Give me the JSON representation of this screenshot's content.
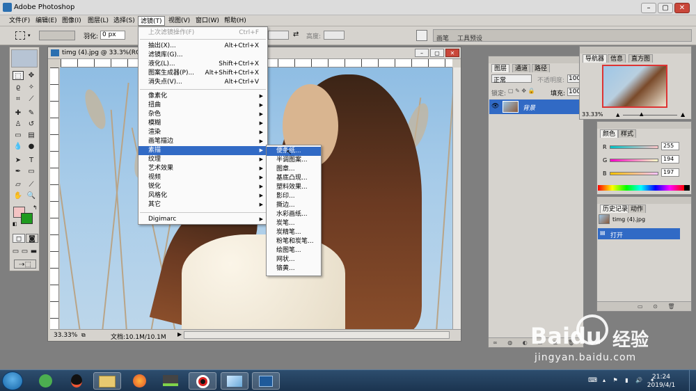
{
  "app": {
    "title": "Adobe Photoshop"
  },
  "menubar": [
    "文件(F)",
    "编辑(E)",
    "图像(I)",
    "图层(L)",
    "选择(S)",
    "滤镜(T)",
    "视图(V)",
    "窗口(W)",
    "帮助(H)"
  ],
  "options": {
    "feather_label": "羽化:",
    "feather_value": "0 px",
    "height_label": "高度:"
  },
  "palette_well": {
    "tabs": [
      "画笔",
      "工具预设"
    ]
  },
  "document": {
    "title": "timg (4).jpg @ 33.3%(RGB",
    "zoom": "33.33%",
    "doc_info": "文档:10.1M/10.1M"
  },
  "filter_menu": {
    "items": [
      {
        "label": "上次滤镜操作(F)",
        "shortcut": "Ctrl+F",
        "disabled": true
      },
      {
        "label": "抽出(X)...",
        "shortcut": "Alt+Ctrl+X"
      },
      {
        "label": "滤镜库(G)...",
        "shortcut": ""
      },
      {
        "label": "液化(L)...",
        "shortcut": "Shift+Ctrl+X"
      },
      {
        "label": "图案生成器(P)...",
        "shortcut": "Alt+Shift+Ctrl+X"
      },
      {
        "label": "消失点(V)...",
        "shortcut": "Alt+Ctrl+V"
      },
      {
        "label": "像素化",
        "submenu": true
      },
      {
        "label": "扭曲",
        "submenu": true
      },
      {
        "label": "杂色",
        "submenu": true
      },
      {
        "label": "模糊",
        "submenu": true
      },
      {
        "label": "渲染",
        "submenu": true
      },
      {
        "label": "画笔描边",
        "submenu": true
      },
      {
        "label": "素描",
        "submenu": true,
        "highlighted": true
      },
      {
        "label": "纹理",
        "submenu": true
      },
      {
        "label": "艺术效果",
        "submenu": true
      },
      {
        "label": "视频",
        "submenu": true
      },
      {
        "label": "锐化",
        "submenu": true
      },
      {
        "label": "风格化",
        "submenu": true
      },
      {
        "label": "其它",
        "submenu": true
      },
      {
        "label": "Digimarc",
        "submenu": true
      }
    ]
  },
  "sketch_submenu": {
    "items": [
      "便条纸...",
      "半调图案...",
      "图章...",
      "基底凸现...",
      "塑料效果...",
      "影印...",
      "撕边...",
      "水彩画纸...",
      "炭笔...",
      "炭精笔...",
      "粉笔和炭笔...",
      "绘图笔...",
      "网状...",
      "铬黄..."
    ],
    "highlighted_index": 0
  },
  "layers_panel": {
    "tabs": [
      "图层",
      "通道",
      "路径"
    ],
    "blend_mode": "正常",
    "opacity_label": "不透明度:",
    "opacity_value": "100",
    "lock_label": "锁定:",
    "fill_label": "填充:",
    "fill_value": "100",
    "layer_name": "背景"
  },
  "navigator_panel": {
    "tabs": [
      "导航器",
      "信息",
      "直方图"
    ],
    "zoom": "33.33%"
  },
  "color_panel": {
    "tabs": [
      "颜色",
      "样式"
    ],
    "channels": [
      {
        "name": "R",
        "value": "255"
      },
      {
        "name": "G",
        "value": "194"
      },
      {
        "name": "B",
        "value": "197"
      }
    ]
  },
  "history_panel": {
    "tabs": [
      "历史记录",
      "动作"
    ],
    "snapshot": "timg (4).jpg",
    "step": "打开"
  },
  "taskbar": {
    "time": "21:24",
    "date": "2019/4/1"
  },
  "watermark": {
    "brand": "Baidu",
    "product": "经验",
    "url": "jingyan.baidu.com"
  },
  "colors": {
    "highlight": "#316ac5",
    "foreground_swatch": "#f4c4c4",
    "background_swatch": "#1f9a1f"
  }
}
